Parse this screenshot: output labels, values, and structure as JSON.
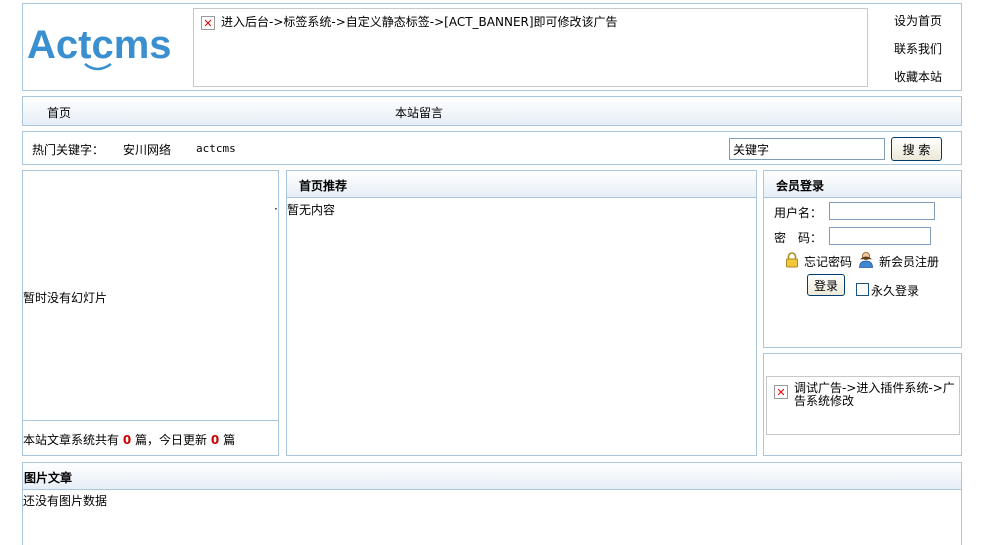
{
  "header": {
    "logo_text": "Actcms",
    "banner_text": "进入后台->标签系统->自定义静态标签->[ACT_BANNER]即可修改该广告",
    "links": [
      "设为首页",
      "联系我们",
      "收藏本站"
    ]
  },
  "nav": {
    "items": [
      "首页",
      "本站留言"
    ]
  },
  "search": {
    "hot_label": "热门关键字：",
    "keywords": [
      "安川网络",
      "actcms"
    ],
    "input_value": "关键字",
    "button_label": "搜 索"
  },
  "slideshow": {
    "empty_text": "暂时没有幻灯片",
    "stats_prefix": "本站文章系统共有",
    "total_count": "0",
    "stats_middle": "篇，今日更新",
    "today_count": "0",
    "stats_suffix": "篇"
  },
  "recommend": {
    "title": "首页推荐",
    "empty_text": "暂无内容"
  },
  "login": {
    "title": "会员登录",
    "username_label": "用户名：",
    "password_label": "密　码：",
    "forgot_label": "忘记密码",
    "register_label": "新会员注册",
    "login_button": "登录",
    "remember_label": "永久登录"
  },
  "ad": {
    "text": "调试广告->进入插件系统->广告系统修改"
  },
  "pictures": {
    "title": "图片文章",
    "empty_text": "还没有图片数据"
  },
  "colors": {
    "brand_blue": "#3a8fd0",
    "border_blue": "#a9c6dc",
    "count_red": "#d00000"
  }
}
